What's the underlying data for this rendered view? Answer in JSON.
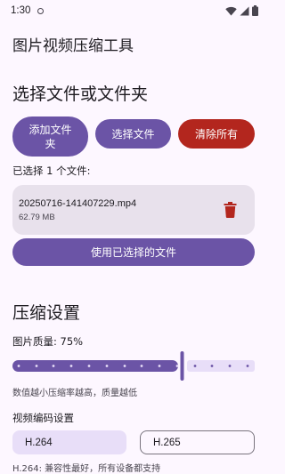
{
  "status_bar": {
    "time": "1:30"
  },
  "app": {
    "title": "图片视频压缩工具"
  },
  "select_section": {
    "title": "选择文件或文件夹",
    "add_folder_label": "添加文件夹",
    "select_file_label": "选择文件",
    "clear_all_label": "清除所有",
    "selected_count_label": "已选择 1 个文件:"
  },
  "files": [
    {
      "name": "20250716-141407229.mp4",
      "size": "62.79 MB"
    }
  ],
  "use_selected_label": "使用已选择的文件",
  "compress_section": {
    "title": "压缩设置",
    "quality_label": "图片质量: 75%",
    "quality_value": 75,
    "quality_hint": "数值越小压缩率越高，质量越低",
    "video_codec_title": "视频编码设置",
    "codec_options": [
      "H.264",
      "H.265"
    ],
    "codec_selected": "H.264",
    "codec_hint": "H.264: 兼容性最好，所有设备都支持"
  },
  "colors": {
    "primary": "#6b54a6",
    "danger": "#b3261e",
    "background": "#fdf7ff",
    "surface_variant": "#e8e1ec"
  }
}
